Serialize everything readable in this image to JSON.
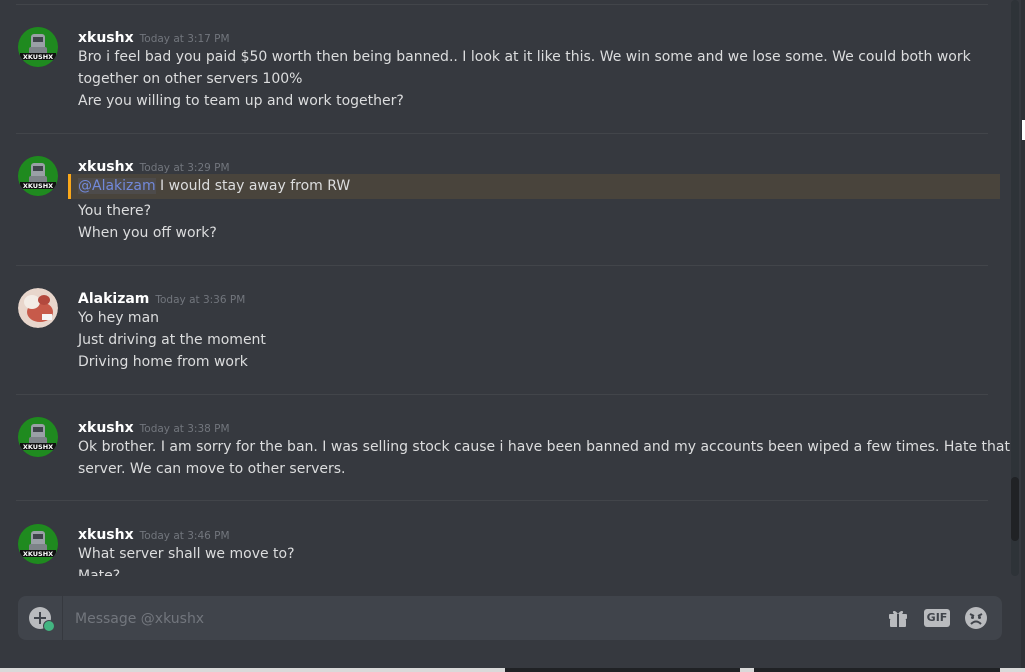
{
  "messages": [
    {
      "author": "xkushx",
      "timestamp": "Today at 3:17 PM",
      "avatar": "xkushx-avatar",
      "lines": [
        "Bro i feel bad you paid $50 worth then being banned.. I look at it like this. We win some and we lose some. We could both work",
        "together on other servers 100%",
        "Are you willing to team up and work together?"
      ]
    },
    {
      "author": "xkushx",
      "timestamp": "Today at 3:29 PM",
      "avatar": "xkushx-avatar",
      "mention": "@Alakizam",
      "mention_rest": " I would stay away from RW",
      "lines": [
        "You there?",
        "When you off work?"
      ]
    },
    {
      "author": "Alakizam",
      "timestamp": "Today at 3:36 PM",
      "avatar": "alakizam-avatar",
      "lines": [
        "Yo hey man",
        "Just driving at the moment",
        "Driving home from work"
      ]
    },
    {
      "author": "xkushx",
      "timestamp": "Today at 3:38 PM",
      "avatar": "xkushx-avatar",
      "lines": [
        "Ok brother. I am sorry for the ban. I was selling stock cause i have been banned and my accounts been wiped a few times. Hate that",
        "server. We can move to other servers."
      ]
    },
    {
      "author": "xkushx",
      "timestamp": "Today at 3:46 PM",
      "avatar": "xkushx-avatar",
      "lines": [
        "What server shall we move to?",
        "Mate?"
      ]
    }
  ],
  "avatar_text": "XKUSHX",
  "composer": {
    "placeholder": "Message @xkushx",
    "gif_label": "GIF",
    "icons": [
      "add-attachment-icon",
      "gift-icon",
      "gif-icon",
      "emoji-icon"
    ]
  },
  "colors": {
    "background": "#36393f",
    "composer": "#40444b",
    "mention_highlight": "#49443c",
    "mention_bar": "#faa81a",
    "mention_text": "#7289da",
    "username": "#ffffff",
    "timestamp": "#72767d"
  }
}
